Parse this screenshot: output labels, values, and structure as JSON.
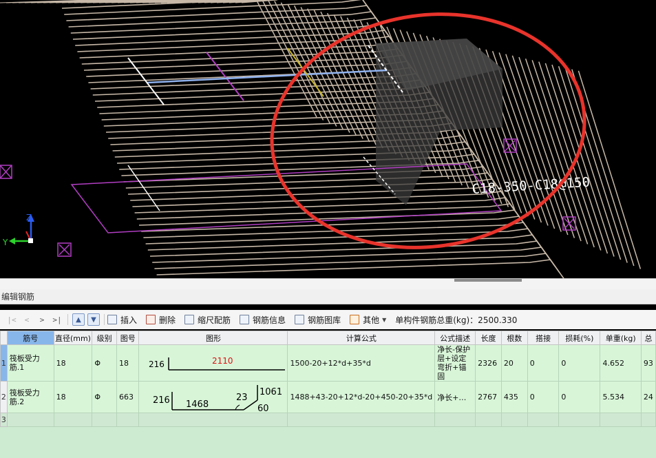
{
  "viewport": {
    "dimension_text": "C18-350-C18@150",
    "axis_labels": {
      "z": "Z",
      "y": "Y"
    },
    "marker_icons": [
      "close-box-icon",
      "close-box-icon",
      "close-box-icon",
      "close-box-icon"
    ],
    "colors": {
      "background": "#000000",
      "rebar": "#c8b9a8",
      "annotation_circle": "#e8332b",
      "outline": "#b23ec4",
      "selected_bar": "#8fb2ee",
      "highlight_mark": "#c8b52a"
    }
  },
  "panel": {
    "title": "编辑钢筋"
  },
  "toolbar": {
    "nav": [
      "|<",
      "<",
      ">",
      ">|"
    ],
    "buttons": [
      {
        "label": "插入",
        "icon": "insert-icon"
      },
      {
        "label": "删除",
        "icon": "delete-icon"
      },
      {
        "label": "缩尺配筋",
        "icon": "scale-icon"
      },
      {
        "label": "钢筋信息",
        "icon": "document-icon"
      },
      {
        "label": "钢筋图库",
        "icon": "library-icon"
      },
      {
        "label": "其他",
        "icon": "other-icon"
      }
    ],
    "total_label": "单构件钢筋总重(kg)：2500.330"
  },
  "grid": {
    "columns": [
      "筋号",
      "直径(mm)",
      "级别",
      "图号",
      "图形",
      "计算公式",
      "公式描述",
      "长度",
      "根数",
      "搭接",
      "损耗(%)",
      "单重(kg)",
      "总"
    ],
    "rows": [
      {
        "row_num": "1",
        "name": "筏板受力筋.1",
        "diameter": "18",
        "grade": "Φ",
        "shape_no": "18",
        "shape_labels": {
          "hook": "216",
          "length": "2110"
        },
        "formula": "1500-20+12*d+35*d",
        "description": "净长-保护层+设定弯折+锚固",
        "length": "2326",
        "count": "20",
        "lap": "0",
        "loss": "0",
        "unit_weight": "4.652",
        "total_weight": "93"
      },
      {
        "row_num": "2",
        "name": "筏板受力筋.2",
        "diameter": "18",
        "grade": "Φ",
        "shape_no": "663",
        "shape_labels": {
          "hook": "216",
          "length": "1468",
          "angle_seg": "23",
          "vertical": "1061",
          "bottom": "60"
        },
        "formula": "1488+43-20+12*d-20+450-20+35*d",
        "description": "净长+…",
        "length": "2767",
        "count": "435",
        "lap": "0",
        "loss": "0",
        "unit_weight": "5.534",
        "total_weight": "24"
      }
    ],
    "empty_row_num": "3"
  }
}
